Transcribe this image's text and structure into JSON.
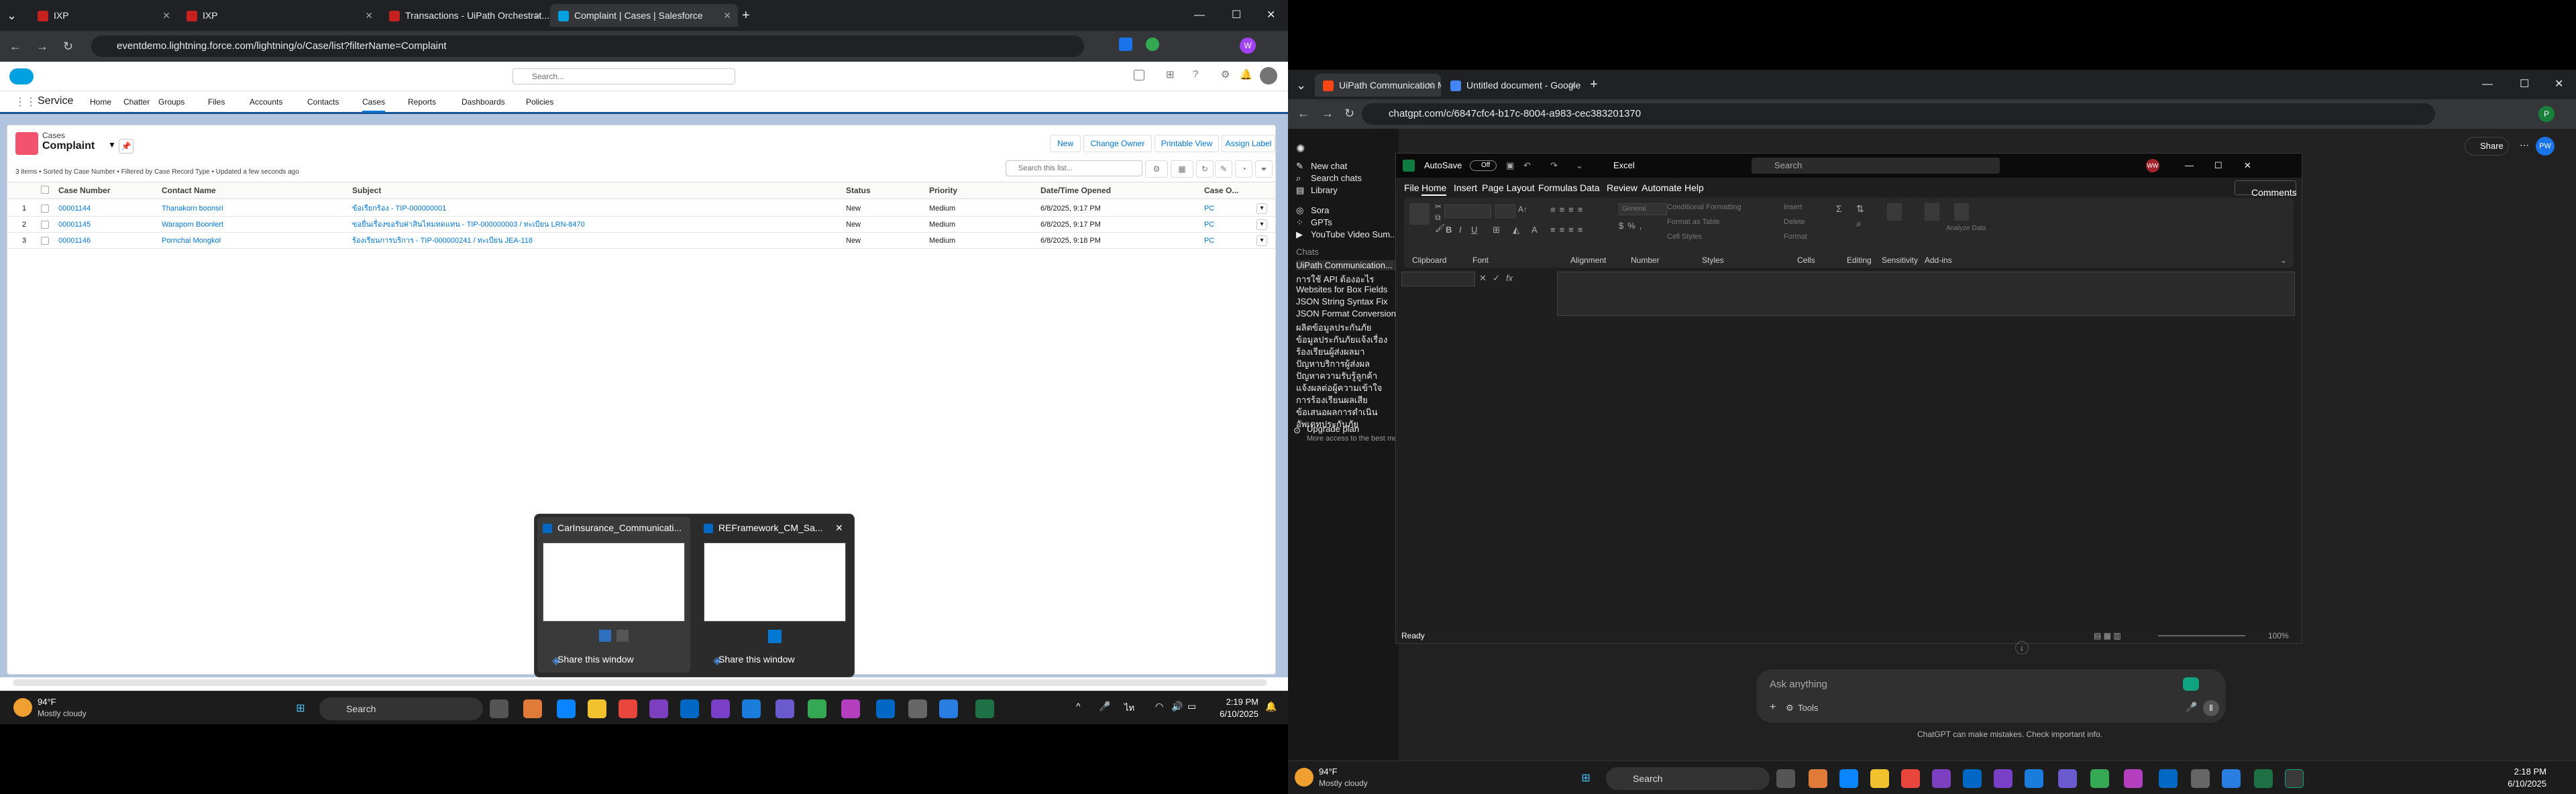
{
  "left": {
    "browser": {
      "tabs": [
        {
          "title": "IXP",
          "fav": "#c5221f"
        },
        {
          "title": "IXP",
          "fav": "#c5221f"
        },
        {
          "title": "Transactions - UiPath Orchestrat...",
          "fav": "#c5221f"
        },
        {
          "title": "Complaint | Cases | Salesforce",
          "fav": "#00a1e0"
        }
      ],
      "url": "eventdemo.lightning.force.com/lightning/o/Case/list?filterName=Complaint"
    },
    "salesforce": {
      "search_placeholder": "Search...",
      "app_name": "Service",
      "nav_items": [
        "Home",
        "Chatter",
        "Groups",
        "Files",
        "Accounts",
        "Contacts",
        "Cases",
        "Reports",
        "Dashboards",
        "Policies"
      ],
      "object_label": "Cases",
      "list_view_name": "Complaint",
      "buttons": [
        "New",
        "Change Owner",
        "Printable View",
        "Assign Label"
      ],
      "list_search_placeholder": "Search this list...",
      "list_meta": "3 items • Sorted by Case Number • Filtered by Case Record Type • Updated a few seconds ago",
      "columns": [
        "Case Number",
        "Contact Name",
        "Subject",
        "Status",
        "Priority",
        "Date/Time Opened",
        "Case O..."
      ],
      "rows": [
        {
          "n": "1",
          "case": "00001144",
          "contact": "Thanakorn boonsri",
          "subject": "ข้อเรียกร้อง - TIP-000000001",
          "status": "New",
          "priority": "Medium",
          "opened": "6/8/2025, 9:17 PM",
          "owner": "PC"
        },
        {
          "n": "2",
          "case": "00001145",
          "contact": "Waraporn Boonlert",
          "subject": "ขอยื่นเรื่องขอรับค่าสินไหมทดแทน - TIP-000000003 / ทะเบียน LRN-8470",
          "status": "New",
          "priority": "Medium",
          "opened": "6/8/2025, 9:17 PM",
          "owner": "PC"
        },
        {
          "n": "3",
          "case": "00001146",
          "contact": "Pornchai Mongkol",
          "subject": "ร้องเรียนการบริการ - TIP-000000241 / ทะเบียน JEA-118",
          "status": "New",
          "priority": "Medium",
          "opened": "6/8/2025, 9:18 PM",
          "owner": "PC"
        }
      ]
    },
    "thumbs": [
      {
        "title": "CarInsurance_Communicati...",
        "share": "Share this window"
      },
      {
        "title": "REFramework_CM_Sa...",
        "share": "Share this window"
      }
    ],
    "taskbar": {
      "weather_temp": "94°F",
      "weather_desc": "Mostly cloudy",
      "search": "Search",
      "time": "2:19 PM",
      "date": "6/10/2025"
    }
  },
  "right": {
    "browser": {
      "tabs": [
        {
          "title": "UiPath Communication Mining..."
        },
        {
          "title": "Untitled document - Google Do..."
        }
      ],
      "url": "chatgpt.com/c/6847cfc4-b17c-8004-a983-cec383201370"
    },
    "chatgpt": {
      "new_chat": "New chat",
      "search_chats": "Search chats",
      "library": "Library",
      "sora": "Sora",
      "gpts": "GPTs",
      "youtube": "YouTube Video Sum...",
      "chats_header": "Chats",
      "chats": [
        "UiPath Communication...",
        "การใช้ API ต้องอะไร",
        "Websites for Box Fields",
        "JSON String Syntax Fix",
        "JSON Format Conversion",
        "ผลิตข้อมูลประกันภัย",
        "ข้อมูลประกันภัยแจ้งเรื่อง",
        "ร้องเรียนผู้ส่งผลมา",
        "ปัญหาบริการผู้ส่งผล",
        "ปัญหาความรับรู้ลูกค้า",
        "แจ้งผลต่อผู้ความเข้าใจ",
        "การร้องเรียนผลเสีย",
        "ข้อเสนอผลการดำเนิน",
        "อัพเดทประกันภัย"
      ],
      "upgrade": "Upgrade plan",
      "upgrade_sub": "More access to the best models",
      "share": "Share",
      "ask_placeholder": "Ask anything",
      "tools": "Tools",
      "disclaimer": "ChatGPT can make mistakes. Check important info."
    },
    "excel": {
      "autosave": "AutoSave",
      "autosave_state": "Off",
      "app": "Excel",
      "search": "Search",
      "menu": [
        "File",
        "Home",
        "Insert",
        "Page Layout",
        "Formulas",
        "Data",
        "Review",
        "Automate",
        "Help"
      ],
      "comments": "Comments",
      "groups": [
        "Clipboard",
        "Font",
        "Alignment",
        "Number",
        "Styles",
        "Cells",
        "Editing",
        "Sensitivity",
        "Add-ins"
      ],
      "ribbon_items": [
        "Conditional Formatting",
        "Format as Table",
        "Cell Styles",
        "Insert",
        "Delete",
        "Format",
        "Analyze Data",
        "General"
      ],
      "status": "Ready",
      "zoom": "100%"
    },
    "taskbar": {
      "weather_temp": "94°F",
      "weather_desc": "Mostly cloudy",
      "search": "Search",
      "time": "2:18 PM",
      "date": "6/10/2025"
    }
  }
}
